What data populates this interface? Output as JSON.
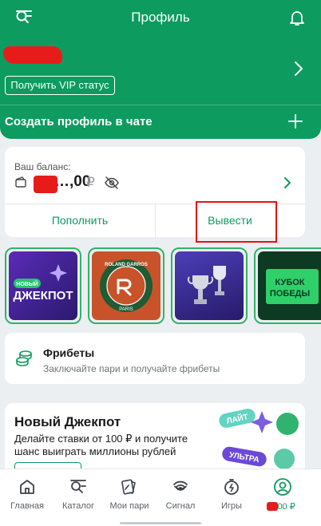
{
  "header": {
    "title": "Профиль",
    "vip_button": "Получить VIP статус",
    "create_chat_profile": "Создать профиль в чате",
    "username_redacted": "████"
  },
  "balance": {
    "label": "Ваш баланс:",
    "amount": "…,00",
    "currency": "₽",
    "topup_button": "Пополнить",
    "withdraw_button": "Вывести"
  },
  "promos": [
    {
      "name": "new-jackpot-promo",
      "text_line1": "НОВЫЙ",
      "text_line2": "ДЖЕКПОТ"
    },
    {
      "name": "roland-garros-promo",
      "text_top": "ROLAND GARROS",
      "text_bottom": "PARIS"
    },
    {
      "name": "cup-promo"
    },
    {
      "name": "kubok-pobedy-promo",
      "text_line1": "КУБОК",
      "text_line2": "ПОБЕДЫ"
    }
  ],
  "freebets": {
    "title": "Фрибеты",
    "subtitle": "Заключайте пари и получайте фрибеты"
  },
  "jackpot": {
    "title": "Новый Джекпот",
    "description": "Делайте ставки от 100 ₽ и получите шанс выиграть миллионы рублей",
    "art_tag_1": "ЛАЙТ",
    "art_tag_2": "УЛЬТРА"
  },
  "bottom_nav": [
    {
      "label": "Главная",
      "icon": "home-icon"
    },
    {
      "label": "Каталог",
      "icon": "catalog-icon"
    },
    {
      "label": "Мои пари",
      "icon": "my-bets-icon"
    },
    {
      "label": "Сигнал",
      "icon": "signal-icon"
    },
    {
      "label": "Игры",
      "icon": "games-icon"
    },
    {
      "label": "0,00 ₽",
      "icon": "profile-icon"
    }
  ],
  "colors": {
    "brand_green": "#0d9b5f",
    "highlight_red": "#e01414"
  }
}
